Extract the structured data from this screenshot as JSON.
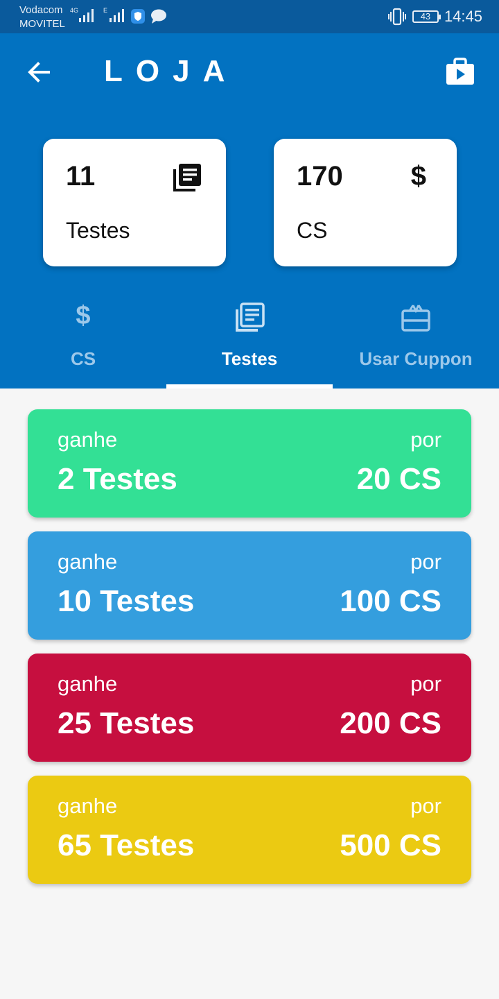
{
  "status_bar": {
    "carrier_1": "Vodacom",
    "carrier_2": "MOVITEL",
    "network_1": "4G",
    "network_2": "E",
    "battery": "43",
    "time": "14:45"
  },
  "header": {
    "title": "LOJA",
    "back_icon": "arrow-back-icon",
    "store_icon": "play-store-bag-icon"
  },
  "stats": [
    {
      "value": "11",
      "label": "Testes",
      "icon": "library-books-icon"
    },
    {
      "value": "170",
      "label": "CS",
      "icon": "dollar-icon"
    }
  ],
  "tabs": [
    {
      "label": "CS",
      "icon": "dollar-icon",
      "active": false
    },
    {
      "label": "Testes",
      "icon": "library-books-icon",
      "active": true
    },
    {
      "label": "Usar Cuppon",
      "icon": "gift-card-icon",
      "active": false
    }
  ],
  "offers": [
    {
      "earn_label": "ganhe",
      "amount": "2 Testes",
      "for_label": "por",
      "price": "20 CS",
      "color": "#33e095"
    },
    {
      "earn_label": "ganhe",
      "amount": "10 Testes",
      "for_label": "por",
      "price": "100 CS",
      "color": "#349ede"
    },
    {
      "earn_label": "ganhe",
      "amount": "25 Testes",
      "for_label": "por",
      "price": "200 CS",
      "color": "#c60f3f"
    },
    {
      "earn_label": "ganhe",
      "amount": "65 Testes",
      "for_label": "por",
      "price": "500 CS",
      "color": "#ebca12"
    }
  ],
  "colors": {
    "primary": "#0272c1",
    "status_bar": "#0a5a9c",
    "background": "#f6f6f6"
  }
}
